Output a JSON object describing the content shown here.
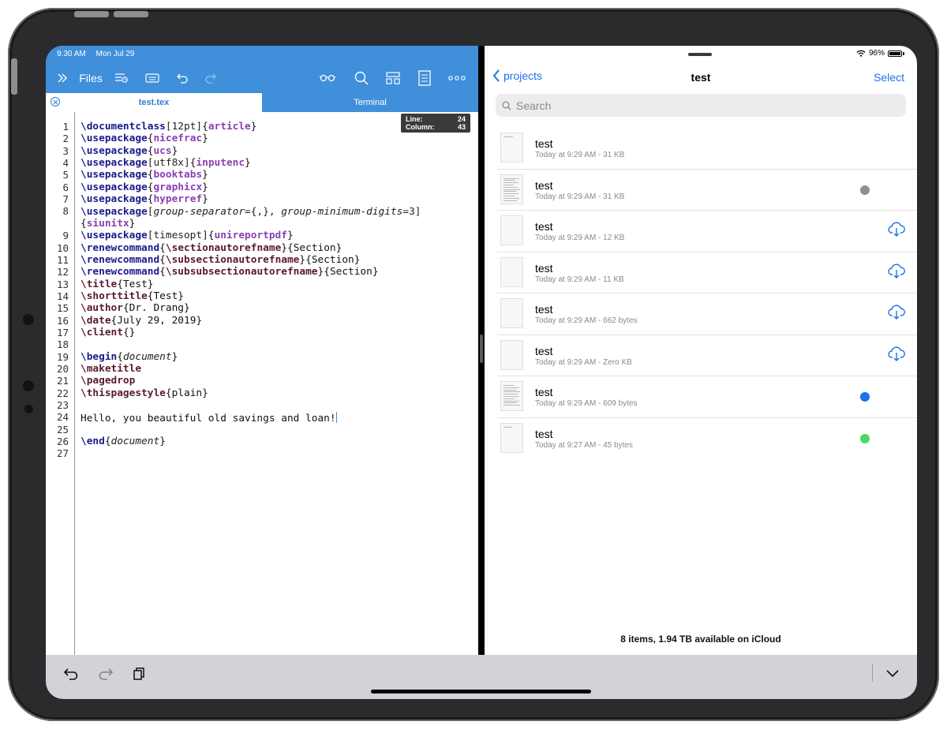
{
  "status_left": {
    "time": "9:30 AM",
    "date": "Mon Jul 29"
  },
  "status_right": {
    "battery": "96%"
  },
  "editor_toolbar": {
    "files_label": "Files",
    "icons": [
      "sidebar-toggle-icon",
      "outline-icon",
      "keyboard-icon",
      "undo-icon",
      "redo-icon",
      "preview-glasses-icon",
      "search-icon",
      "structure-icon",
      "document-icon",
      "more-icon"
    ]
  },
  "tabs": {
    "active": "test.tex",
    "inactive": "Terminal"
  },
  "linecol": {
    "line_label": "Line:",
    "line_value": "24",
    "col_label": "Column:",
    "col_value": "43"
  },
  "line_numbers": [
    "1",
    "2",
    "3",
    "4",
    "5",
    "6",
    "7",
    "8",
    "",
    "9",
    "10",
    "11",
    "12",
    "13",
    "14",
    "15",
    "16",
    "17",
    "18",
    "19",
    "20",
    "21",
    "22",
    "23",
    "24",
    "25",
    "26",
    "27"
  ],
  "code": {
    "l1": {
      "c": "\\documentclass",
      "o": "[12pt]",
      "a": "article"
    },
    "l2": {
      "c": "\\usepackage",
      "a": "nicefrac"
    },
    "l3": {
      "c": "\\usepackage",
      "a": "ucs"
    },
    "l4": {
      "c": "\\usepackage",
      "o": "[utf8x]",
      "a": "inputenc"
    },
    "l5": {
      "c": "\\usepackage",
      "a": "booktabs"
    },
    "l6": {
      "c": "\\usepackage",
      "a": "graphicx"
    },
    "l7": {
      "c": "\\usepackage",
      "a": "hyperref"
    },
    "l8": {
      "c": "\\usepackage",
      "o1": "[",
      "i1": "group-separator",
      "o2": "={,}, ",
      "i2": "group-minimum-digits",
      "o3": "=3]"
    },
    "l8b": {
      "a": "siunitx"
    },
    "l9": {
      "c": "\\usepackage",
      "o": "[timesopt]",
      "a": "unireportpdf"
    },
    "l10": {
      "c": "\\renewcommand",
      "c2": "\\sectionautorefname",
      "t": "Section"
    },
    "l11": {
      "c": "\\renewcommand",
      "c2": "\\subsectionautorefname",
      "t": "Section"
    },
    "l12": {
      "c": "\\renewcommand",
      "c2": "\\subsubsectionautorefname",
      "t": "Section"
    },
    "l13": {
      "c": "\\title",
      "t": "Test"
    },
    "l14": {
      "c": "\\shorttitle",
      "t": "Test"
    },
    "l15": {
      "c": "\\author",
      "t": "Dr. Drang"
    },
    "l16": {
      "c": "\\date",
      "t": "July 29, 2019"
    },
    "l17": {
      "c": "\\client",
      "t": ""
    },
    "l19": {
      "c": "\\begin",
      "i": "document"
    },
    "l20": {
      "c": "\\maketitle"
    },
    "l21": {
      "c": "\\pagedrop"
    },
    "l22": {
      "c": "\\thispagestyle",
      "t": "plain"
    },
    "l24": {
      "t": "Hello, you beautiful old savings and loan!"
    },
    "l26": {
      "c": "\\end",
      "i": "document"
    }
  },
  "files_app": {
    "back_label": "projects",
    "title": "test",
    "select_label": "Select",
    "search_placeholder": "Search",
    "items": [
      {
        "name": "test",
        "meta": "Today at 9:29 AM - 31 KB",
        "status": "none"
      },
      {
        "name": "test",
        "meta": "Today at 9:29 AM - 31 KB",
        "status": "tag",
        "tag_color": "#8e8e93"
      },
      {
        "name": "test",
        "meta": "Today at 9:29 AM - 12 KB",
        "status": "cloud"
      },
      {
        "name": "test",
        "meta": "Today at 9:29 AM - 11 KB",
        "status": "cloud"
      },
      {
        "name": "test",
        "meta": "Today at 9:29 AM - 662 bytes",
        "status": "cloud"
      },
      {
        "name": "test",
        "meta": "Today at 9:29 AM - Zero KB",
        "status": "cloud"
      },
      {
        "name": "test",
        "meta": "Today at 9:29 AM - 609 bytes",
        "status": "tag",
        "tag_color": "#1a73e8"
      },
      {
        "name": "test",
        "meta": "Today at 9:27 AM - 45 bytes",
        "status": "tag",
        "tag_color": "#4cd964"
      }
    ],
    "footer": "8 items, 1.94 TB available on iCloud"
  },
  "colors": {
    "accent": "#3f8fdb",
    "link": "#1a73e8",
    "keyword": "#1a1a8c",
    "argument": "#8b3fb2"
  }
}
